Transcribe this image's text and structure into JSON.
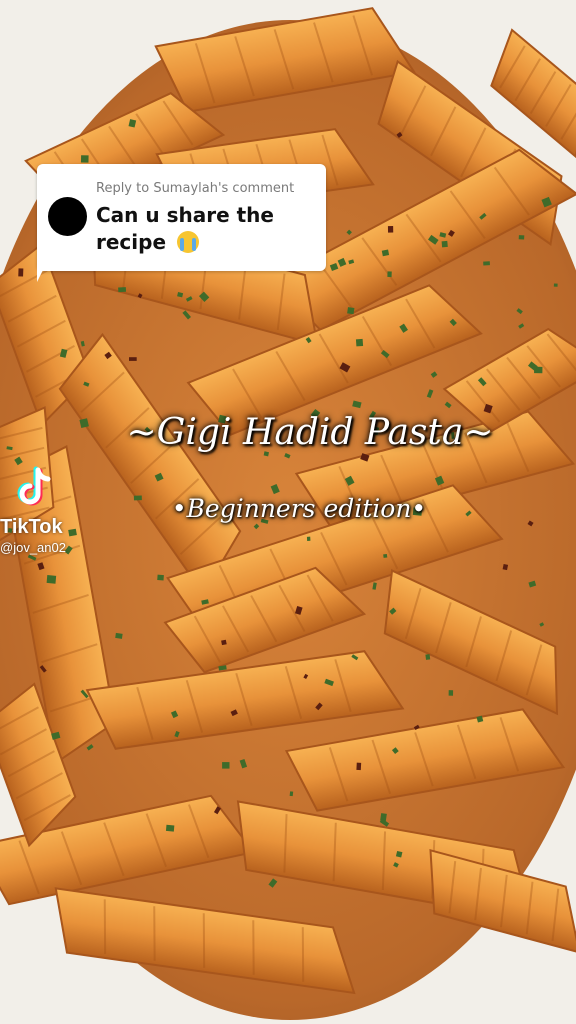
{
  "reply": {
    "header": "Reply to Sumaylah's comment",
    "text": "Can u share the recipe",
    "emoji": "loudly-crying-face-icon"
  },
  "title": "~Gigi Hadid Pasta~",
  "subtitle": "•Beginners edition•",
  "watermark": {
    "brand": "TikTok",
    "handle": "@jov_an02",
    "icon": "tiktok-logo-icon"
  },
  "colors": {
    "pasta": "#e89238",
    "sauce": "#d9782a",
    "plate": "#f2efe9",
    "parsley": "#3f6b2a"
  }
}
